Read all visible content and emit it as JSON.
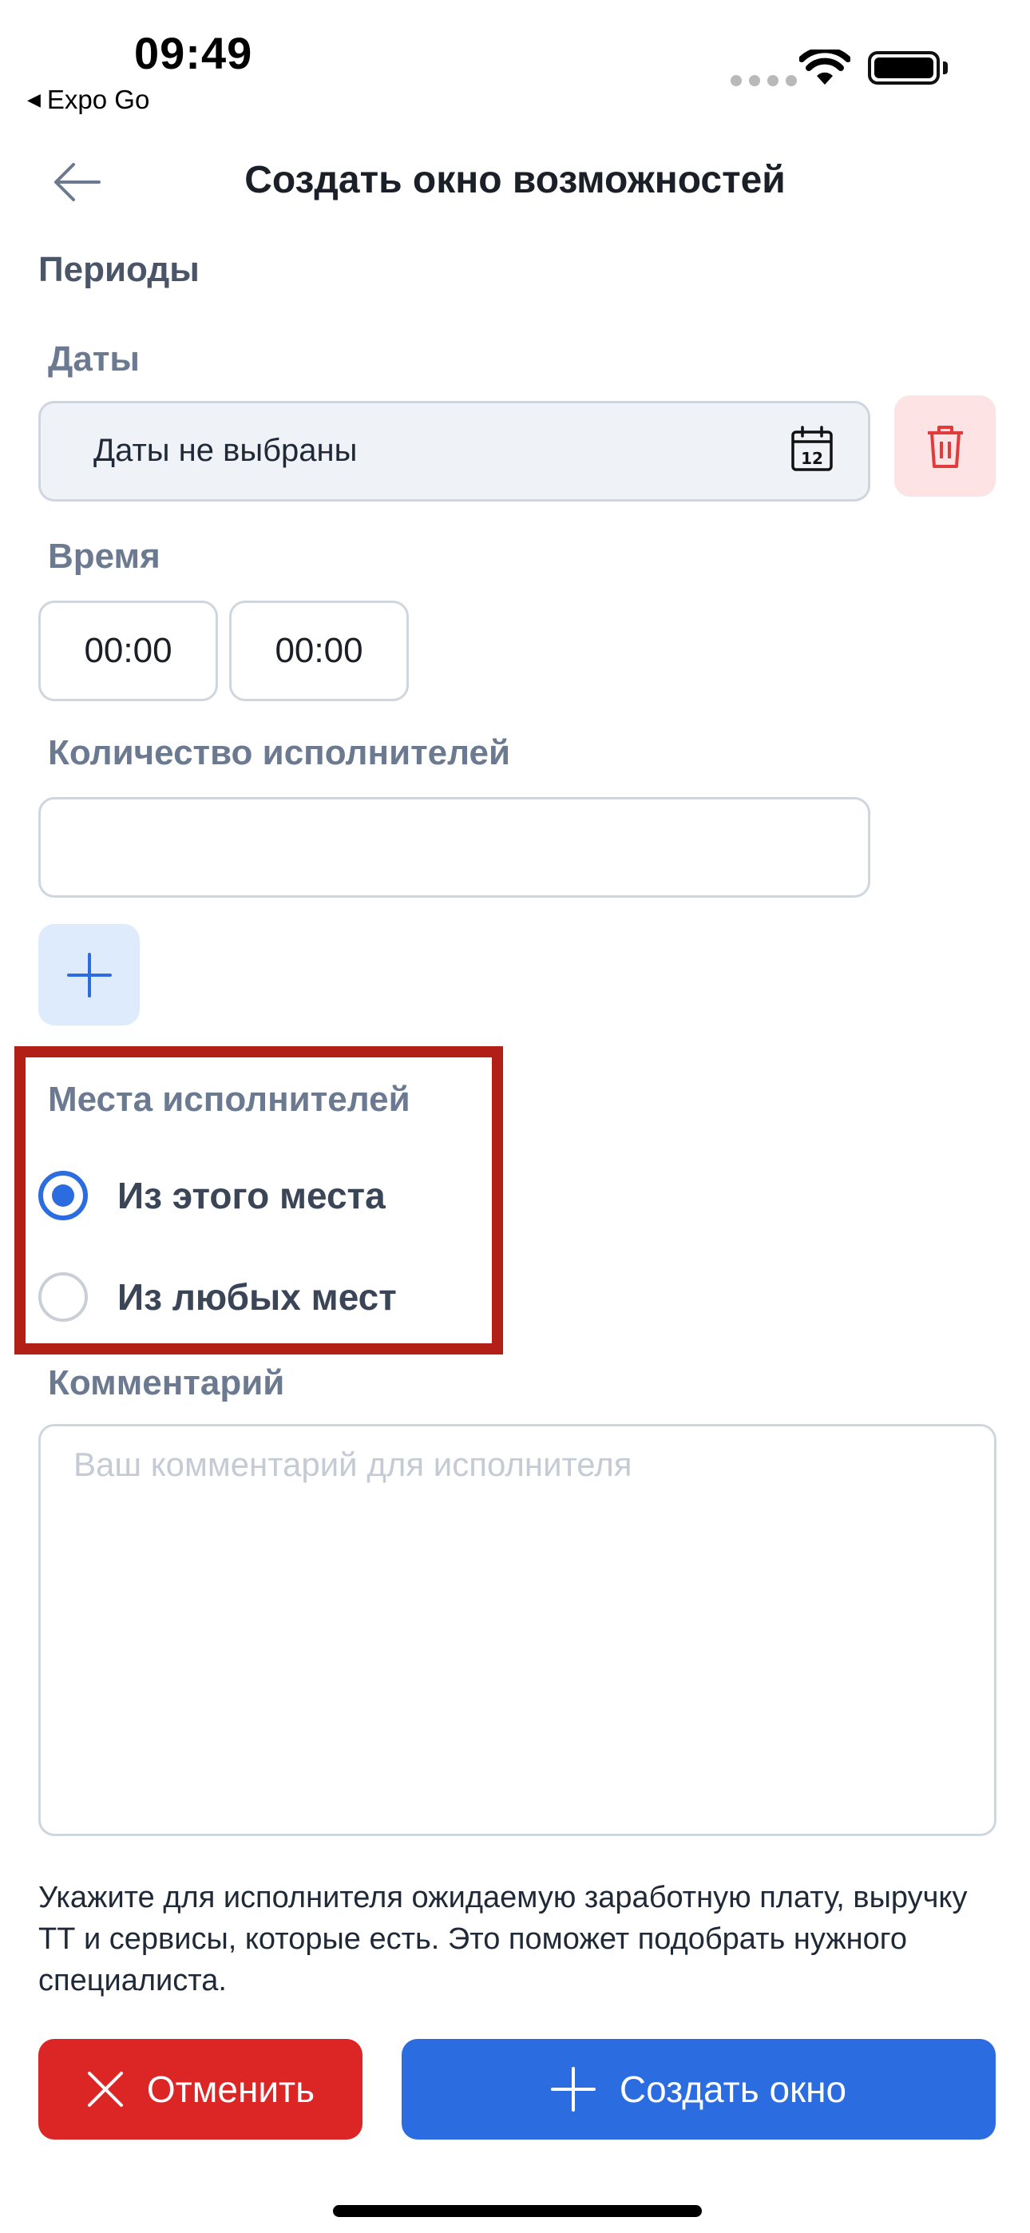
{
  "status_bar": {
    "time": "09:49",
    "back_app_label": "Expo Go",
    "back_app_icon": "triangle-left-icon"
  },
  "header": {
    "title": "Создать окно возможностей",
    "back_icon": "arrow-left-icon"
  },
  "form": {
    "section_title": "Периоды",
    "dates": {
      "label": "Даты",
      "value": "Даты не выбраны",
      "icon": "calendar-icon",
      "calendar_day": "12",
      "delete_icon": "trash-icon"
    },
    "time": {
      "label": "Время",
      "from": "00:00",
      "to": "00:00"
    },
    "performers_count": {
      "label": "Количество исполнителей",
      "value": ""
    },
    "add_period_icon": "plus-icon",
    "places": {
      "label": "Места исполнителей",
      "options": [
        {
          "label": "Из этого места",
          "selected": true
        },
        {
          "label": "Из любых мест",
          "selected": false
        }
      ]
    },
    "comment": {
      "label": "Комментарий",
      "placeholder": "Ваш комментарий для исполнителя",
      "value": ""
    },
    "hint": "Укажите для исполнителя ожидаемую заработную плату, выручку ТТ и сервисы, которые есть. Это поможет подобрать нужного специалиста."
  },
  "actions": {
    "cancel_label": "Отменить",
    "cancel_icon": "close-icon",
    "create_label": "Создать окно",
    "create_icon": "plus-icon"
  },
  "colors": {
    "primary": "#2b6ce0",
    "danger": "#dc2626",
    "danger_light": "#fde3e3",
    "primary_light": "#deebfc",
    "highlight_border": "#b21f16"
  }
}
